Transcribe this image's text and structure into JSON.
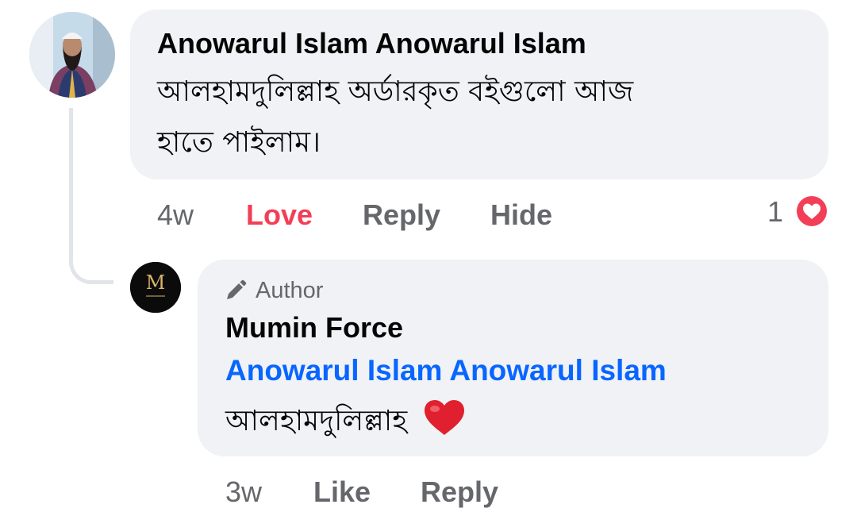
{
  "comment": {
    "author_name": "Anowarul Islam Anowarul Islam",
    "text_line_1": "আলহামদুলিল্লাহ অর্ডারকৃত বইগুলো আজ",
    "text_line_2": "হাতে পাইলাম।",
    "time": "4w",
    "love_label": "Love",
    "reply_label": "Reply",
    "hide_label": "Hide",
    "reaction_count": "1",
    "reaction_icon": "love-reaction-icon",
    "love_color": "#f33e58"
  },
  "reply": {
    "author_badge": "Author",
    "author_badge_icon": "pencil-icon",
    "author_name": "Mumin Force",
    "mention": "Anowarul Islam Anowarul Islam",
    "text": "আলহামদুলিল্লাহ",
    "emoji_icon": "red-heart-emoji",
    "time": "3w",
    "like_label": "Like",
    "reply_label": "Reply",
    "mention_color": "#0866ff"
  },
  "colors": {
    "bubble": "#f0f2f5",
    "meta_text": "#65676b",
    "primary_text": "#050505"
  }
}
